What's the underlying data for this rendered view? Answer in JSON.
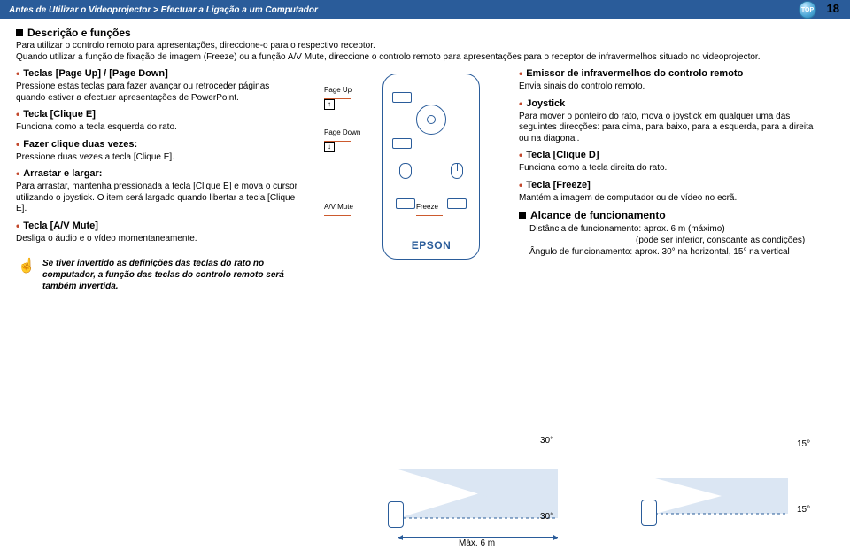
{
  "header": {
    "breadcrumb": "Antes de Utilizar o Videoprojector > Efectuar a Ligação a um Computador",
    "top_label": "TOP",
    "page_number": "18"
  },
  "title": "Descrição e funções",
  "intro": "Para utilizar o controlo remoto para apresentações, direccione-o para o respectivo receptor.\nQuando utilizar a função de fixação de imagem (Freeze) ou a função A/V Mute, direccione o controlo remoto para apresentações para o receptor de infravermelhos situado no videoprojector.",
  "left": [
    {
      "title": "Teclas [Page Up] / [Page Down]",
      "desc": "Pressione estas teclas para fazer avançar ou retroceder páginas quando estiver a efectuar apresentações de PowerPoint."
    },
    {
      "title": "Tecla [Clique E]",
      "desc": "Funciona como a tecla esquerda do rato."
    },
    {
      "title": "Fazer clique duas vezes:",
      "desc": "Pressione duas vezes a tecla [Clique E]."
    },
    {
      "title": "Arrastar e largar:",
      "desc": "Para arrastar, mantenha pressionada a tecla [Clique E] e mova o cursor utilizando o joystick. O item será largado quando libertar a tecla [Clique E]."
    },
    {
      "title": "Tecla [A/V Mute]",
      "desc": "Desliga o áudio e o vídeo momentaneamente."
    }
  ],
  "right": [
    {
      "title": "Emissor de infravermelhos do controlo remoto",
      "desc": "Envia sinais do controlo remoto."
    },
    {
      "title": "Joystick",
      "desc": "Para mover o ponteiro do rato, mova o joystick em qualquer uma das seguintes direcções: para cima, para baixo, para a esquerda, para a direita ou na diagonal."
    },
    {
      "title": "Tecla [Clique D]",
      "desc": "Funciona como a tecla direita do rato."
    },
    {
      "title": "Tecla [Freeze]",
      "desc": "Mantém a imagem de computador ou de vídeo no ecrã."
    }
  ],
  "remote": {
    "page_up": "Page Up",
    "page_down": "Page Down",
    "av_mute": "A/V Mute",
    "freeze": "Freeze",
    "brand": "EPSON"
  },
  "tip": "Se tiver invertido as definições das teclas do rato no computador, a função das teclas do controlo remoto será também invertida.",
  "range_title": "Alcance de funcionamento",
  "range_lines": {
    "l1": "Distância de funcionamento: aprox. 6 m (máximo)",
    "l2": "(pode ser inferior, consoante as condições)",
    "l3": "Ângulo de funcionamento: aprox. 30° na horizontal, 15° na vertical"
  },
  "diagram": {
    "a30": "30°",
    "a15": "15°",
    "max": "Máx. 6 m"
  }
}
